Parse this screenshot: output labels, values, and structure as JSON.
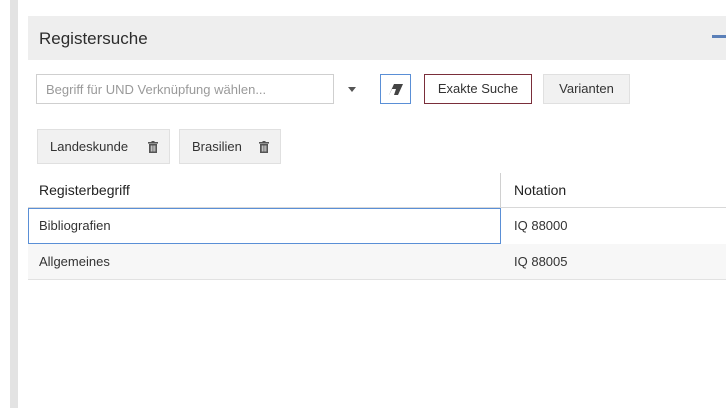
{
  "panel": {
    "title": "Registersuche"
  },
  "search": {
    "placeholder": "Begriff für UND Verknüpfung wählen..."
  },
  "buttons": {
    "exact_search": "Exakte Suche",
    "variants": "Varianten"
  },
  "chips": [
    {
      "label": "Landeskunde"
    },
    {
      "label": "Brasilien"
    }
  ],
  "table": {
    "columns": [
      "Registerbegriff",
      "Notation"
    ],
    "rows": [
      {
        "term": "Bibliografien",
        "notation": "IQ 88000"
      },
      {
        "term": "Allgemeines",
        "notation": "IQ 88005"
      }
    ]
  },
  "colors": {
    "accent": "#5a8fd6",
    "exact_border": "#7a2e3a",
    "header_bg": "#eeeeee"
  },
  "icons": {
    "collapse": "minus-icon",
    "dropdown": "caret-down-icon",
    "eraser": "eraser-icon",
    "remove_chip": "trash-icon"
  }
}
